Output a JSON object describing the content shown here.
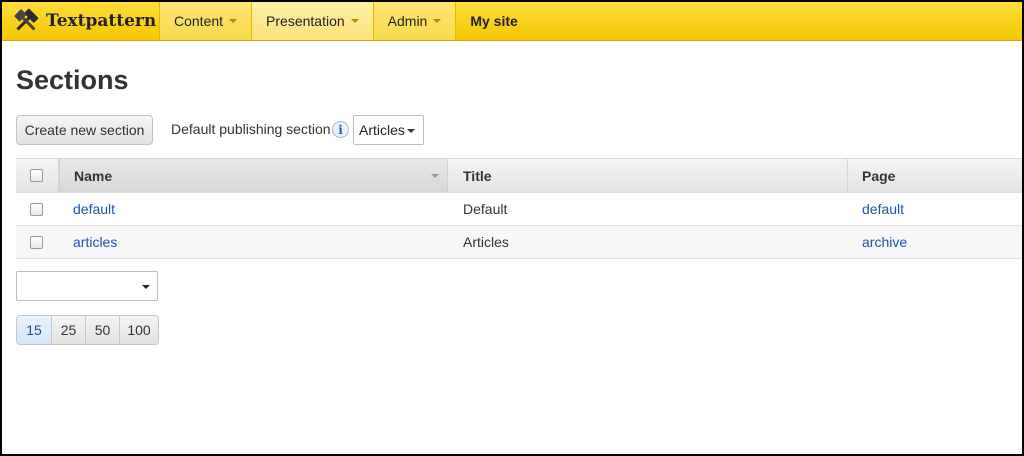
{
  "brand": {
    "name": "Textpattern",
    "icon": "hammer-icon"
  },
  "nav": {
    "content": "Content",
    "presentation": "Presentation",
    "admin": "Admin",
    "my_site": "My site"
  },
  "page": {
    "title": "Sections"
  },
  "toolbar": {
    "create_button": "Create new section",
    "default_publishing_label": "Default publishing section",
    "info_icon_glyph": "i",
    "default_section_value": "Articles"
  },
  "table": {
    "headers": {
      "name": "Name",
      "title": "Title",
      "page": "Page"
    },
    "rows": [
      {
        "name": "default",
        "title": "Default",
        "page": "default"
      },
      {
        "name": "articles",
        "title": "Articles",
        "page": "archive"
      }
    ]
  },
  "bulk": {
    "value": ""
  },
  "pager": {
    "options": [
      "15",
      "25",
      "50",
      "100"
    ],
    "selected": "15"
  },
  "colors": {
    "topbar": "#f5c800",
    "link": "#1a55b3"
  }
}
